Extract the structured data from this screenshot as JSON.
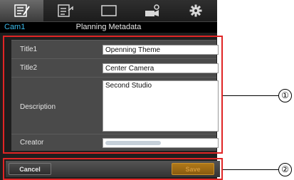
{
  "header": {
    "camera_name": "Cam1",
    "page_title": "Planning Metadata"
  },
  "tabs": [
    {
      "icon": "edit-list-icon",
      "active": true
    },
    {
      "icon": "list-share-icon",
      "active": false
    },
    {
      "icon": "monitor-icon",
      "active": false
    },
    {
      "icon": "camera-settings-icon",
      "active": false
    },
    {
      "icon": "gear-icon",
      "active": false
    }
  ],
  "form": {
    "title1": {
      "label": "Title1",
      "value": "Openning Theme"
    },
    "title2": {
      "label": "Title2",
      "value": "Center Camera"
    },
    "description": {
      "label": "Description",
      "value": "Second Studio"
    },
    "creator": {
      "label": "Creator",
      "value": ""
    }
  },
  "buttons": {
    "cancel": "Cancel",
    "save": "Save"
  },
  "callouts": {
    "form": "①",
    "buttons": "②"
  }
}
